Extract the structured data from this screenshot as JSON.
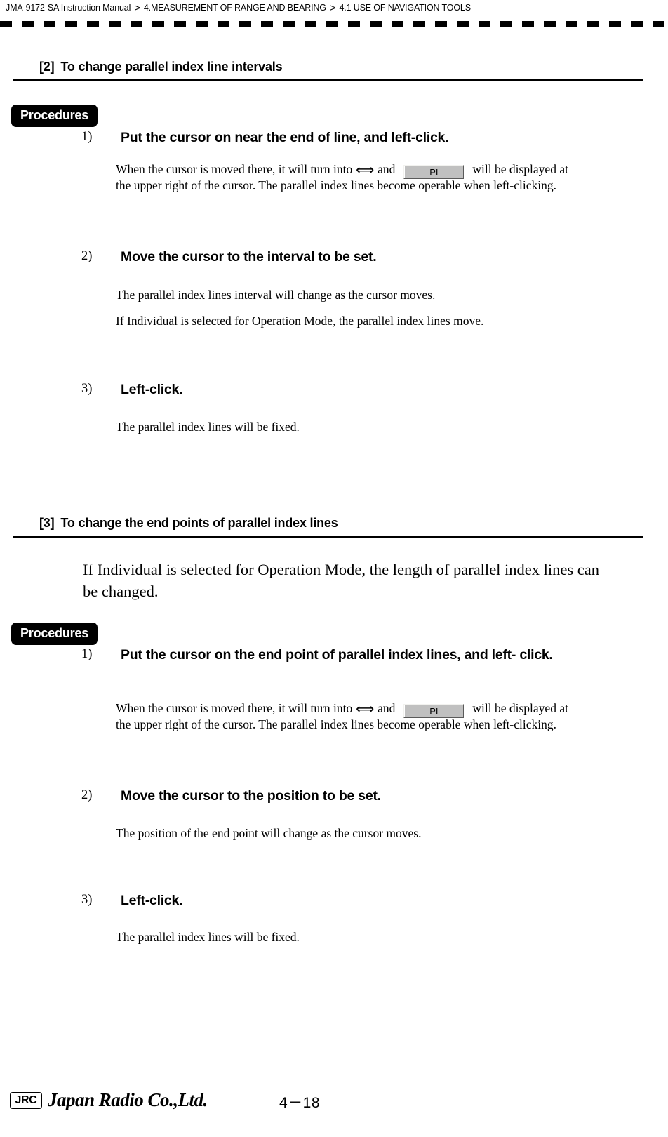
{
  "header": {
    "manual": "JMA-9172-SA Instruction Manual",
    "separator": ">",
    "chapter": "4.MEASUREMENT OF RANGE AND BEARING",
    "section": "4.1  USE OF NAVIGATION TOOLS"
  },
  "sections": [
    {
      "tag": "[2]",
      "title": "To change parallel index line intervals",
      "procedures_label": "Procedures",
      "steps": [
        {
          "num": "1)",
          "title": "Put the cursor on near the end of line, and left-click.",
          "body_pre": "When the cursor is moved there, it will turn into",
          "arrow": "⟺",
          "body_mid": "and",
          "button_label": "PI",
          "body_post": "will be displayed at",
          "body_line2": "the upper right of the cursor. The parallel index lines become operable when left-clicking."
        },
        {
          "num": "2)",
          "title": "Move the cursor to the interval to be set.",
          "body_line1": "The parallel index lines interval will change as the cursor moves.",
          "body_line2": "If Individual is selected for Operation Mode, the parallel index lines move."
        },
        {
          "num": "3)",
          "title": "Left-click.",
          "body_line1": "The parallel index lines will be fixed."
        }
      ]
    },
    {
      "tag": "[3]",
      "title": "To change the end points of parallel index lines",
      "intro_line1": "If Individual is selected for Operation Mode, the length of parallel index lines can",
      "intro_line2": "be changed.",
      "procedures_label": "Procedures",
      "steps": [
        {
          "num": "1)",
          "title_line1": "Put the cursor on the end point of parallel index lines, and left-",
          "title_line2": "click.",
          "body_pre": "When the cursor is moved there, it will turn into",
          "arrow": "⟺",
          "body_mid": "and",
          "button_label": "PI",
          "body_post": "will be displayed at",
          "body_line2": "the upper right of the cursor. The parallel index lines become operable when left-clicking."
        },
        {
          "num": "2)",
          "title": "Move the cursor to the position to be set.",
          "body_line1": "The position of the end point will change as the cursor moves."
        },
        {
          "num": "3)",
          "title": "Left-click.",
          "body_line1": "The parallel index lines will be fixed."
        }
      ]
    }
  ],
  "footer": {
    "logo_mark": "JRC",
    "company": "Japan Radio Co.,Ltd.",
    "page_number": "4－18"
  }
}
